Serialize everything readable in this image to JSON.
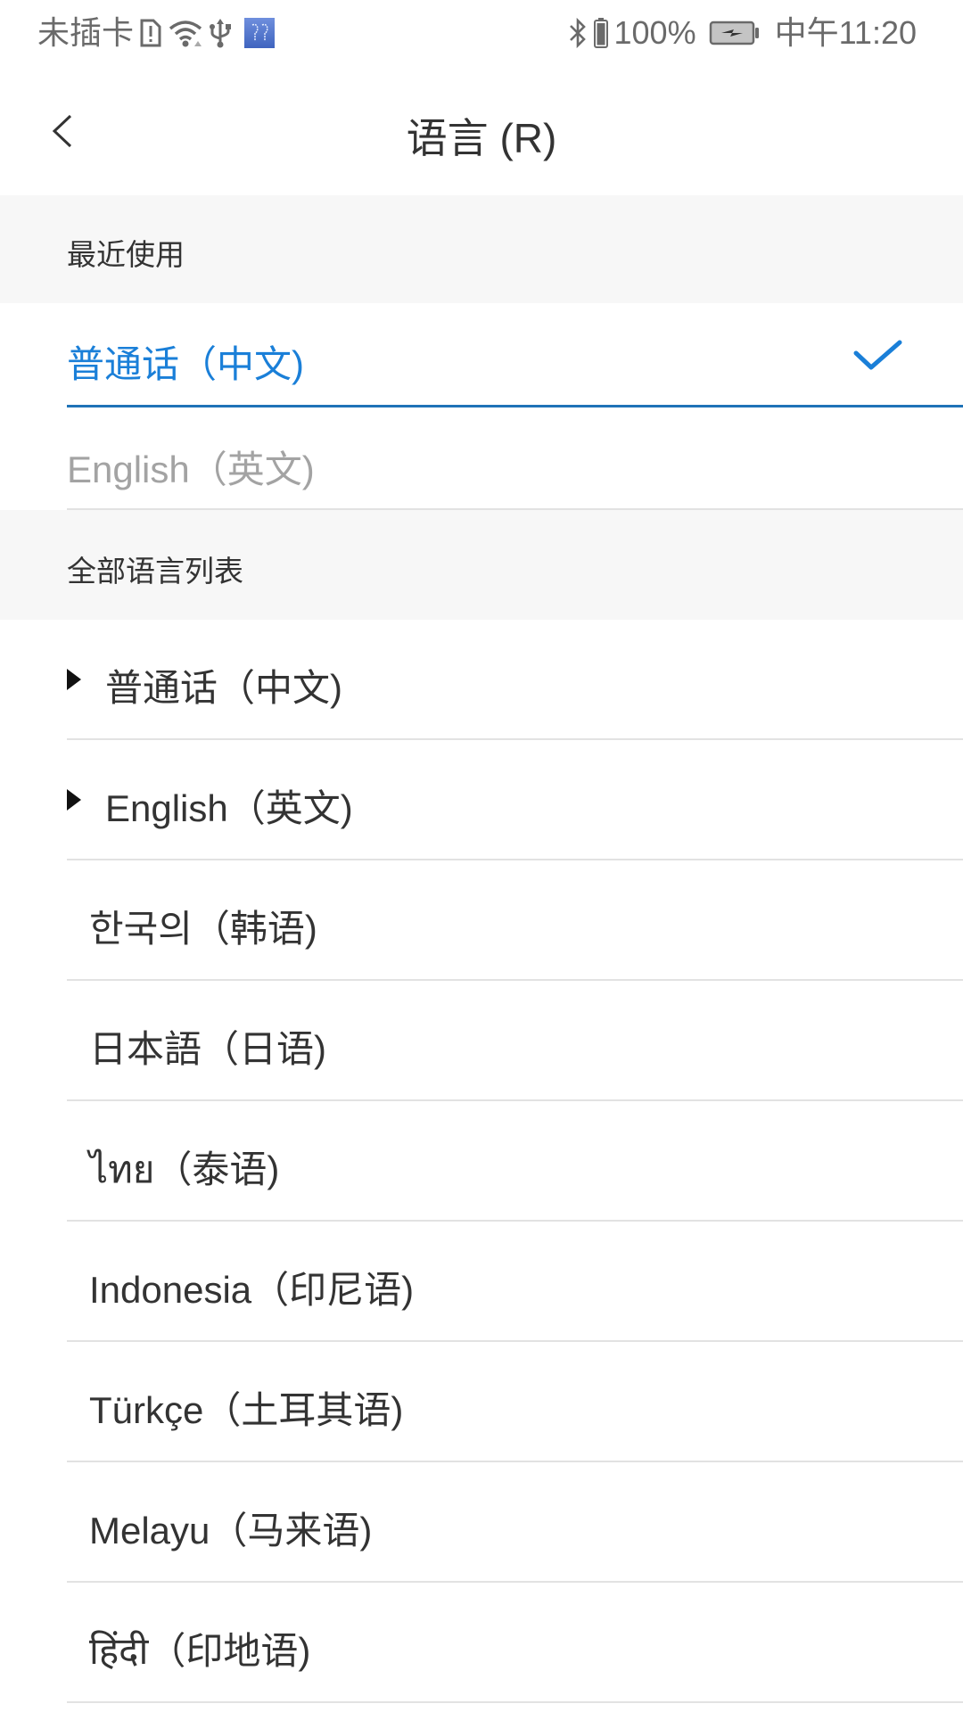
{
  "status_bar": {
    "carrier": "未插卡",
    "icons_left": [
      "sim-alert-icon",
      "wifi-icon",
      "usb-icon",
      "app-notification-icon"
    ],
    "icons_right": [
      "bluetooth-icon",
      "headset-battery-icon"
    ],
    "headset_battery": "100%",
    "time": "中午11:20"
  },
  "header": {
    "back_icon": "chevron-left-icon",
    "title": "语言 (R)"
  },
  "sections": {
    "recent": {
      "title": "最近使用",
      "items": [
        {
          "label": "普通话（中文)",
          "selected": true
        },
        {
          "label": "English（英文)",
          "selected": false
        }
      ]
    },
    "all": {
      "title": "全部语言列表",
      "items": [
        {
          "label": "普通话（中文)",
          "marker": "triangle-right-icon"
        },
        {
          "label": "English（英文)",
          "marker": "triangle-right-icon"
        },
        {
          "label": "한국의（韩语)"
        },
        {
          "label": "日本語（日语)"
        },
        {
          "label": "ไทย（泰语)"
        },
        {
          "label": "Indonesia（印尼语)"
        },
        {
          "label": "Türkçe（土耳其语)"
        },
        {
          "label": "Melayu（马来语)"
        },
        {
          "label": "हिंदी（印地语)"
        }
      ]
    }
  },
  "colors": {
    "accent": "#1a7fd8",
    "selected_underline": "#1f73b7",
    "text": "#333333",
    "muted_text": "#a3a3a3",
    "section_bg": "#f7f7f7",
    "divider": "#e2e2e2"
  }
}
